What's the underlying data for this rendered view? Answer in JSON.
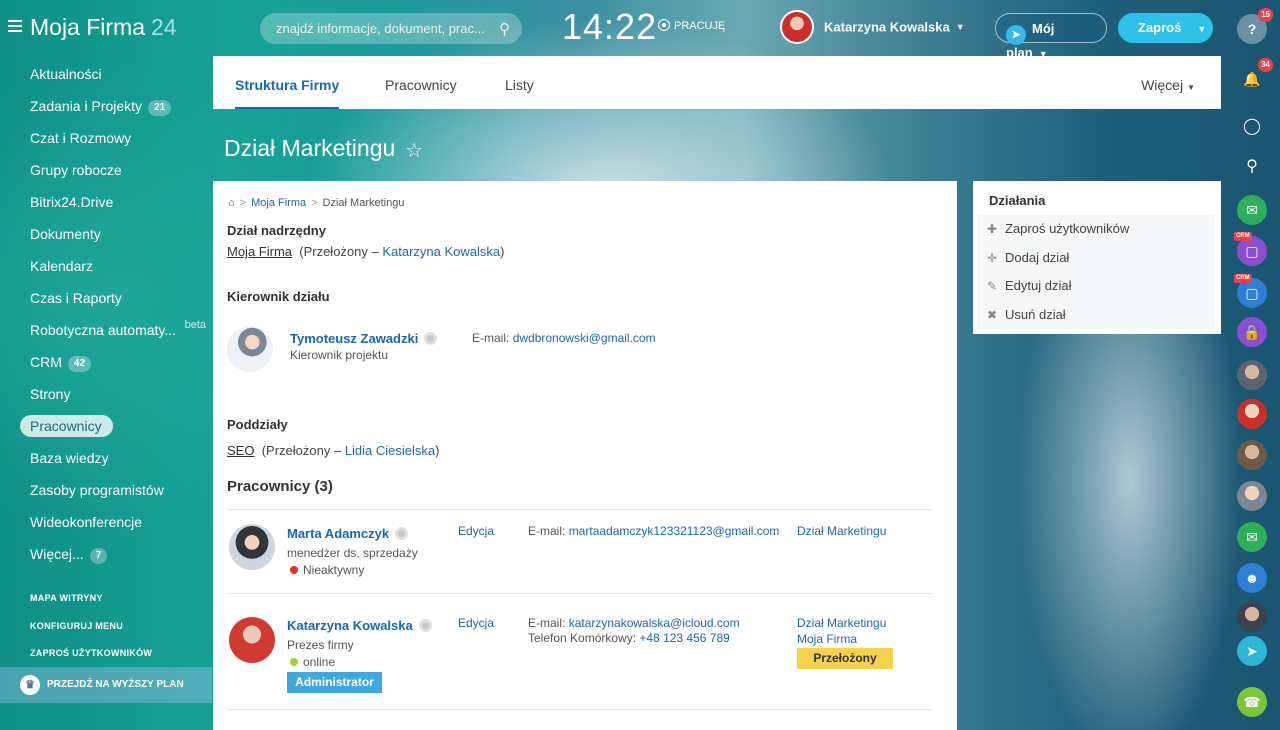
{
  "header": {
    "logo_text": "Moja Firma",
    "logo_number": "24",
    "search_placeholder": "znajdź informacje, dokument, prac...",
    "clock": "14:22",
    "status": "PRACUJĘ",
    "user_name": "Katarzyna Kowalska",
    "plan_button": "Mój plan",
    "invite_button": "Zaproś"
  },
  "sidebar": {
    "items": [
      {
        "label": "Aktualności"
      },
      {
        "label": "Zadania i Projekty",
        "count": "21"
      },
      {
        "label": "Czat i Rozmowy"
      },
      {
        "label": "Grupy robocze"
      },
      {
        "label": "Bitrix24.Drive"
      },
      {
        "label": "Dokumenty"
      },
      {
        "label": "Kalendarz"
      },
      {
        "label": "Czas i Raporty"
      },
      {
        "label": "Robotyczna automaty...",
        "beta": "beta"
      },
      {
        "label": "CRM",
        "count": "42"
      },
      {
        "label": "Strony"
      },
      {
        "label": "Pracownicy"
      },
      {
        "label": "Baza wiedzy"
      },
      {
        "label": "Zasoby programistów"
      },
      {
        "label": "Wideokonferencje"
      },
      {
        "label": "Więcej...",
        "count": "7"
      }
    ],
    "footer": {
      "sitemap": "MAPA WITRYNY",
      "configure": "KONFIGURUJ MENU",
      "invite": "ZAPROŚ UŻYTKOWNIKÓW",
      "upgrade": "PRZEJDŹ NA WYŻSZY PLAN"
    }
  },
  "tabs": {
    "t1": "Struktura Firmy",
    "t2": "Pracownicy",
    "t3": "Listy",
    "more": "Więcej"
  },
  "page": {
    "title": "Dział Marketingu"
  },
  "card": {
    "breadcrumb": {
      "b1": "Moja Firma",
      "b2": "Dział Marketingu"
    },
    "parent": {
      "heading": "Dział nadrzędny",
      "dept": "Moja Firma",
      "pre": "(Przełożony –",
      "boss": "Katarzyna Kowalska",
      "post": ")"
    },
    "head": {
      "heading": "Kierownik działu",
      "name": "Tymoteusz Zawadzki",
      "role": "Kierownik projektu",
      "email_label": "E-mail:",
      "email": "dwdbronowski@gmail.com"
    },
    "sub": {
      "heading": "Poddziały",
      "dept": "SEO",
      "pre": "(Przełożony –",
      "boss": "Lidia Ciesielska",
      "post": ")"
    },
    "employees": {
      "heading": "Pracownicy (3)",
      "e1": {
        "name": "Marta Adamczyk",
        "role": "menedżer ds. sprzedaży",
        "status": "Nieaktywny",
        "edit": "Edycja",
        "email_label": "E-mail:",
        "email": "martaadamczyk123321123@gmail.com",
        "dept": "Dział Marketingu"
      },
      "e2": {
        "name": "Katarzyna Kowalska",
        "role": "Prezes firmy",
        "status": "online",
        "edit": "Edycja",
        "email_label": "E-mail:",
        "email": "katarzynakowalska@icloud.com",
        "phone_label": "Telefon Komórkowy:",
        "phone": "+48 123 456 789",
        "dept1": "Dział Marketingu",
        "dept2": "Moja Firma",
        "badge_boss": "Przełożony",
        "badge_admin": "Administrator"
      }
    }
  },
  "actions": {
    "heading": "Działania",
    "a1": "Zaproś użytkowników",
    "a2": "Dodaj dział",
    "a3": "Edytuj dział",
    "a4": "Usuń dział"
  },
  "rail": {
    "help_badge": "15",
    "notif_badge": "34",
    "crm_tag": "CRM"
  },
  "colors": {
    "accent": "#1767b7",
    "invite": "#2ec2e8",
    "badge_boss": "#f6d24f",
    "badge_admin": "#3fa9dd",
    "offline": "#e03232",
    "online": "#9bd33c"
  }
}
